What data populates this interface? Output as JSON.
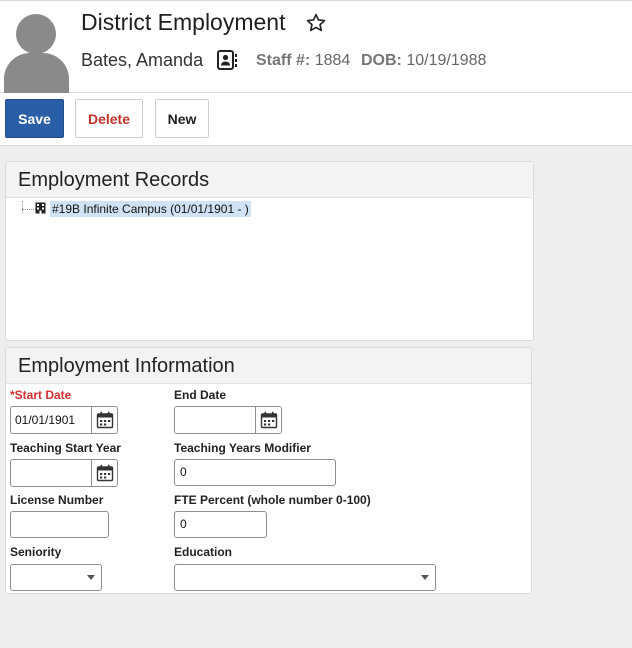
{
  "header": {
    "title": "District Employment",
    "person_name": "Bates, Amanda",
    "staff_label": "Staff #:",
    "staff_value": "1884",
    "dob_label": "DOB:",
    "dob_value": "10/19/1988"
  },
  "toolbar": {
    "save_label": "Save",
    "delete_label": "Delete",
    "new_label": "New"
  },
  "records": {
    "title": "Employment Records",
    "items": [
      {
        "label": "#19B Infinite Campus (01/01/1901 - )"
      }
    ]
  },
  "info": {
    "title": "Employment Information",
    "required_marker": "*",
    "fields": {
      "start_date": {
        "label": "Start Date",
        "value": "01/01/1901"
      },
      "end_date": {
        "label": "End Date",
        "value": ""
      },
      "teaching_start_year": {
        "label": "Teaching Start Year",
        "value": ""
      },
      "teaching_years_modifier": {
        "label": "Teaching Years Modifier",
        "value": "0"
      },
      "license_number": {
        "label": "License Number",
        "value": ""
      },
      "fte_percent": {
        "label": "FTE Percent (whole number 0-100)",
        "value": "0"
      },
      "seniority": {
        "label": "Seniority",
        "value": ""
      },
      "education": {
        "label": "Education",
        "value": ""
      }
    }
  },
  "icons": {
    "favorite": "star-outline-icon",
    "contact": "contact-card-icon",
    "building": "building-icon",
    "calendar": "calendar-icon",
    "dropdown": "chevron-down-icon"
  },
  "colors": {
    "primary": "#2a5ea6",
    "danger": "#c0342b",
    "required": "#d32f2f",
    "selection": "#cfe3f5"
  }
}
